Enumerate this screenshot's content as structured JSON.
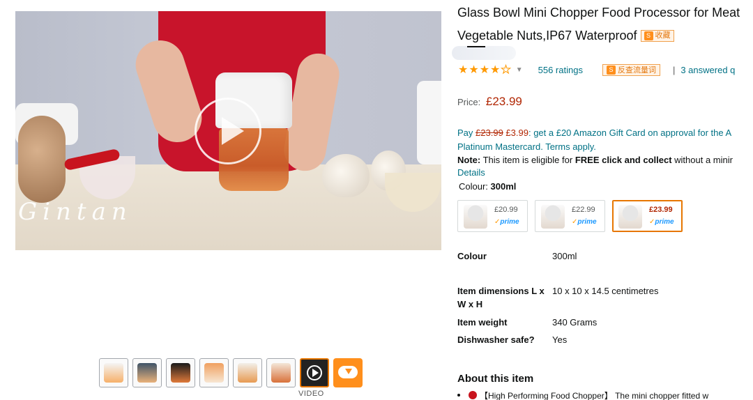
{
  "product": {
    "title_line1": "Glass Bowl Mini Chopper Food Processor for Meat",
    "title_line2": "Vegetable Nuts,IP67 Waterproof",
    "fav_badge": "收藏",
    "rating_count": "556 ratings",
    "stars_filled": 4,
    "stars_total": 5,
    "review_badge": "反查流量词",
    "separator": "|",
    "answered": "3 answered q",
    "price_label": "Price:",
    "price": "£23.99"
  },
  "promo": {
    "pay": "Pay",
    "old_price": "£23.99",
    "new_price": "£3.99",
    "text1": ": get a £20 Amazon Gift Card on approval for the A",
    "text2": "Platinum Mastercard. Terms apply."
  },
  "note": {
    "label": "Note:",
    "text_a": " This item is eligible for ",
    "bold": "FREE click and collect",
    "text_b": " without a minir",
    "details": "Details"
  },
  "colour": {
    "label": "Colour: ",
    "value": "300ml"
  },
  "swatches": [
    {
      "price": "£20.99",
      "prime": "prime",
      "selected": false
    },
    {
      "price": "£22.99",
      "prime": "prime",
      "selected": false
    },
    {
      "price": "£23.99",
      "prime": "prime",
      "selected": true
    }
  ],
  "specs": [
    {
      "key": "Colour",
      "value": "300ml"
    },
    {
      "key": "Item dimensions L x W x H",
      "value": "10 x 10 x 14.5 centimetres"
    },
    {
      "key": "Item weight",
      "value": "340 Grams"
    },
    {
      "key": "Dishwasher safe?",
      "value": "Yes"
    }
  ],
  "about": {
    "title": "About this item",
    "bullet1": "【High Performing Food Chopper】 The mini chopper fitted w"
  },
  "media": {
    "watermark": "Gintan",
    "video_label": "VIDEO",
    "thumb_count": 8
  },
  "colors": {
    "link": "#007185",
    "price": "#b12704",
    "star": "#ff9900",
    "selected_border": "#e77600",
    "cloud_button": "#ff8f1c"
  }
}
